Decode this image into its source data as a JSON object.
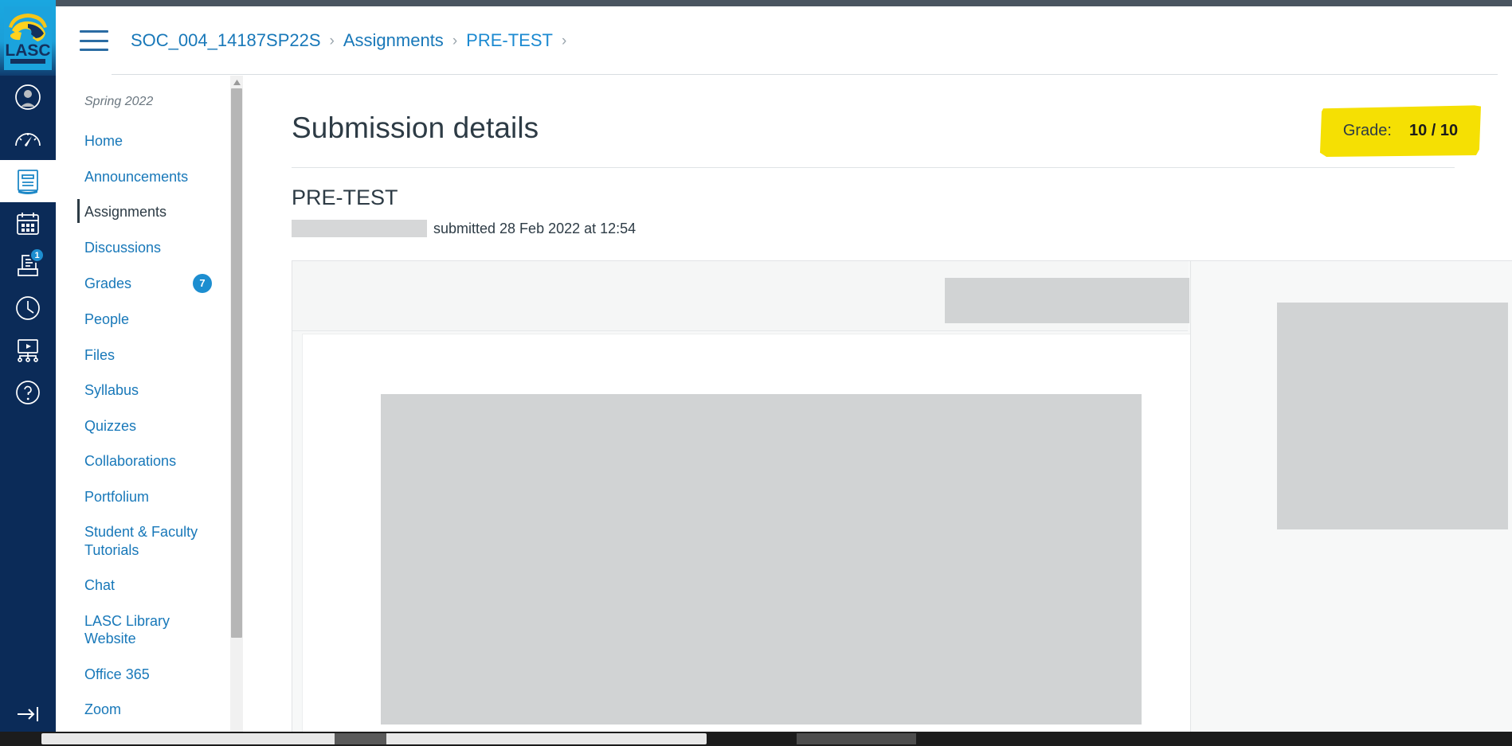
{
  "colors": {
    "global_nav_bg": "#0b2b58",
    "link_blue": "#1878b9",
    "badge_blue": "#1d8ed0",
    "highlight_yellow": "#f5e003",
    "text_dark": "#2d3b45",
    "placeholder_gray": "#d1d3d4"
  },
  "global_nav": {
    "logo_alt": "LASC cougar logo",
    "items": [
      {
        "name": "account",
        "icon": "user-avatar-icon",
        "badge": ""
      },
      {
        "name": "dashboard",
        "icon": "dashboard-gauge-icon",
        "badge": ""
      },
      {
        "name": "courses",
        "icon": "courses-book-icon",
        "badge": "",
        "active": true
      },
      {
        "name": "calendar",
        "icon": "calendar-icon",
        "badge": ""
      },
      {
        "name": "inbox",
        "icon": "inbox-tray-icon",
        "badge": "1"
      },
      {
        "name": "history",
        "icon": "clock-history-icon",
        "badge": ""
      },
      {
        "name": "studio",
        "icon": "studio-screen-icon",
        "badge": ""
      },
      {
        "name": "help",
        "icon": "help-question-icon",
        "badge": ""
      }
    ],
    "expand_icon": "expand-arrow-icon"
  },
  "header": {
    "menu_icon": "hamburger-menu-icon",
    "breadcrumb": [
      {
        "label": "SOC_004_14187SP22S"
      },
      {
        "label": "Assignments"
      },
      {
        "label": "PRE-TEST"
      }
    ],
    "separator": "›"
  },
  "course_nav": {
    "term": "Spring 2022",
    "items": [
      {
        "label": "Home",
        "badge": "",
        "active": false
      },
      {
        "label": "Announcements",
        "badge": "",
        "active": false
      },
      {
        "label": "Assignments",
        "badge": "",
        "active": true
      },
      {
        "label": "Discussions",
        "badge": "",
        "active": false
      },
      {
        "label": "Grades",
        "badge": "7",
        "active": false
      },
      {
        "label": "People",
        "badge": "",
        "active": false
      },
      {
        "label": "Files",
        "badge": "",
        "active": false
      },
      {
        "label": "Syllabus",
        "badge": "",
        "active": false
      },
      {
        "label": "Quizzes",
        "badge": "",
        "active": false
      },
      {
        "label": "Collaborations",
        "badge": "",
        "active": false
      },
      {
        "label": "Portfolium",
        "badge": "",
        "active": false
      },
      {
        "label": "Student & Faculty Tutorials",
        "badge": "",
        "active": false
      },
      {
        "label": "Chat",
        "badge": "",
        "active": false
      },
      {
        "label": "LASC Library Website",
        "badge": "",
        "active": false
      },
      {
        "label": "Office 365",
        "badge": "",
        "active": false
      },
      {
        "label": "Zoom",
        "badge": "",
        "active": false
      }
    ],
    "scroll_up_icon": "scroll-up-arrow-icon"
  },
  "main": {
    "page_title": "Submission details",
    "assignment_name": "PRE-TEST",
    "submitted_text": "submitted 28 Feb 2022 at 12:54",
    "student_name_redacted": ""
  },
  "grade": {
    "label": "Grade:",
    "score": "10 / 10",
    "highlighted": true
  }
}
